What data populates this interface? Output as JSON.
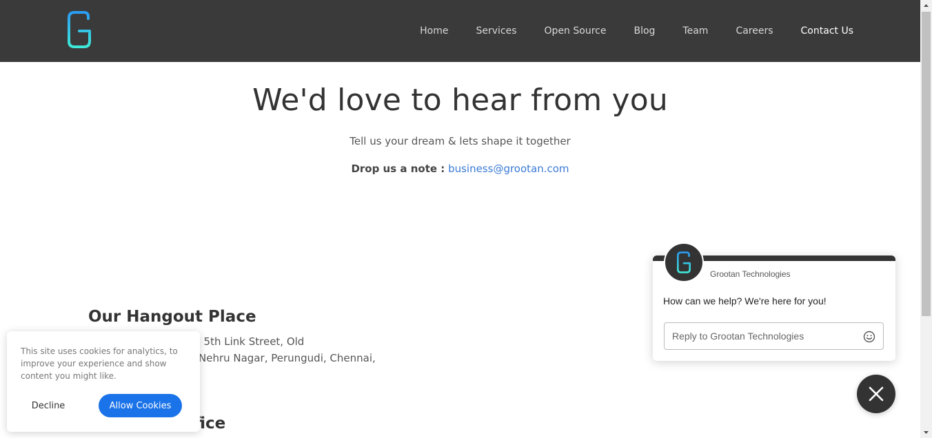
{
  "header": {
    "logo_icon": "grootan-g-logo-icon",
    "nav": [
      {
        "label": "Home"
      },
      {
        "label": "Services"
      },
      {
        "label": "Open Source"
      },
      {
        "label": "Blog"
      },
      {
        "label": "Team"
      },
      {
        "label": "Careers"
      },
      {
        "label": "Contact Us",
        "active": true
      }
    ]
  },
  "hero": {
    "title": "We'd love to hear from you",
    "subtitle": "Tell us your dream & lets shape it together",
    "note_label": "Drop us a note :",
    "note_email": "business@grootan.com"
  },
  "hangout": {
    "title": "Our Hangout Place",
    "address_line1": ", 5th Link Street, Old",
    "address_line2": "Nehru Nagar, Perungudi, Chennai,"
  },
  "office": {
    "title_fragment": "fice"
  },
  "cookie": {
    "text": "This site uses cookies for analytics, to improve your experience and show content you might like.",
    "decline": "Decline",
    "allow": "Allow Cookies"
  },
  "chat": {
    "company": "Grootan Technologies",
    "message": "How can we help? We're here for you!",
    "input_placeholder": "Reply to Grootan Technologies",
    "emoji_icon": "smiley-icon",
    "close_icon": "close-icon"
  },
  "colors": {
    "header_bg": "#3a3a3a",
    "link": "#3a7bd5",
    "cookie_button": "#1a73e8",
    "logo_gradient_top": "#2b9cf2",
    "logo_gradient_bottom": "#3ee8d8"
  }
}
